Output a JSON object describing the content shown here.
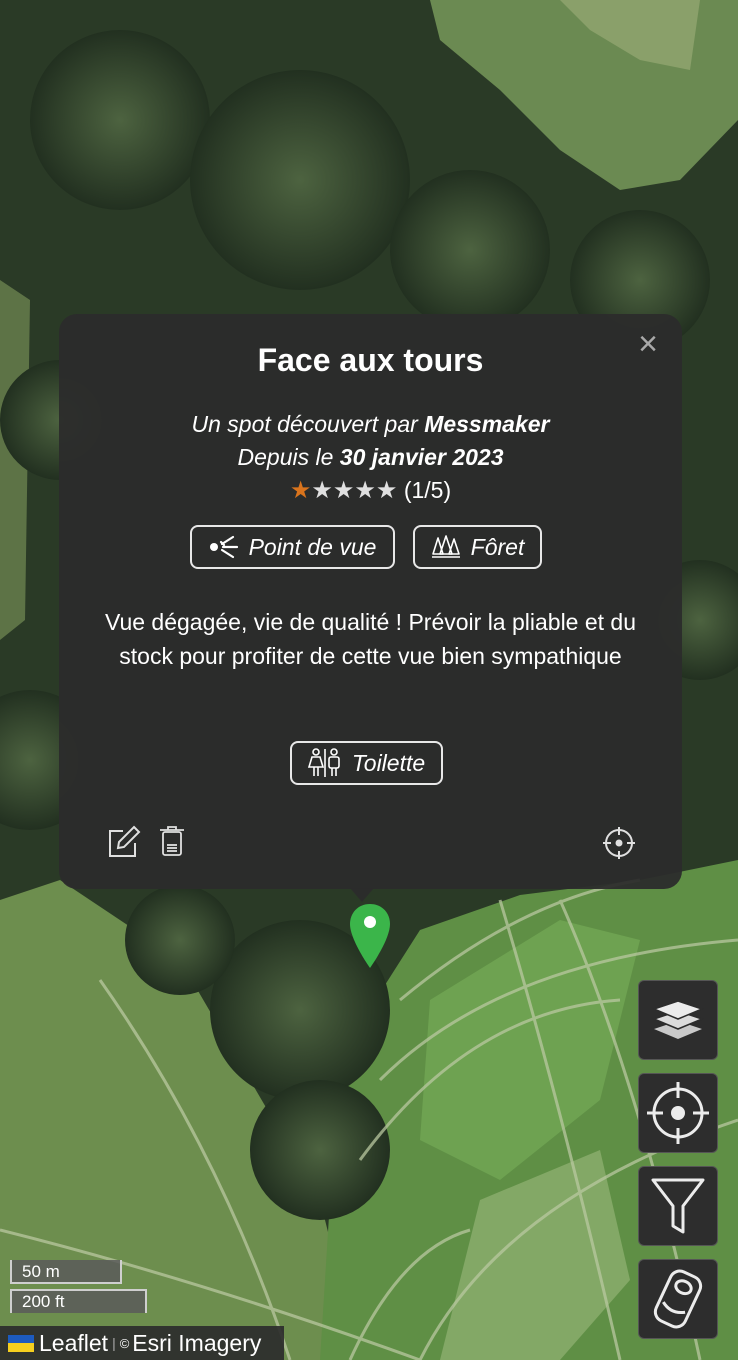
{
  "popup": {
    "title": "Face aux tours",
    "discovered_prefix": "Un spot découvert par ",
    "author": "Messmaker",
    "since_prefix": "Depuis le ",
    "date": "30 janvier 2023",
    "rating": 1,
    "rating_max": 5,
    "rating_text": "(1/5)",
    "tags": [
      "Point de vue",
      "Fôret"
    ],
    "description": "Vue dégagée, vie de qualité ! Prévoir la pliable et du stock pour profiter de cette vue bien sympathique",
    "amenity": "Toilette",
    "close_symbol": "×"
  },
  "icons": {
    "close": "close-icon",
    "viewpoint": "viewpoint-icon",
    "forest": "forest-icon",
    "toilet": "toilet-icon",
    "edit": "edit-icon",
    "delete": "trash-icon",
    "center": "crosshair-icon",
    "marker": "map-marker-icon",
    "layers": "layers-icon",
    "locate": "locate-icon",
    "filter": "filter-icon",
    "can": "can-icon"
  },
  "colors": {
    "marker": "#3bb54a",
    "star_on": "#d9741d",
    "popup_bg": "#2c2c2c"
  },
  "scale": {
    "metric": "50 m",
    "imperial": "200 ft"
  },
  "attribution": {
    "leaflet": "Leaflet",
    "separator": "|",
    "copyright": "©",
    "imagery": "Esri Imagery"
  }
}
